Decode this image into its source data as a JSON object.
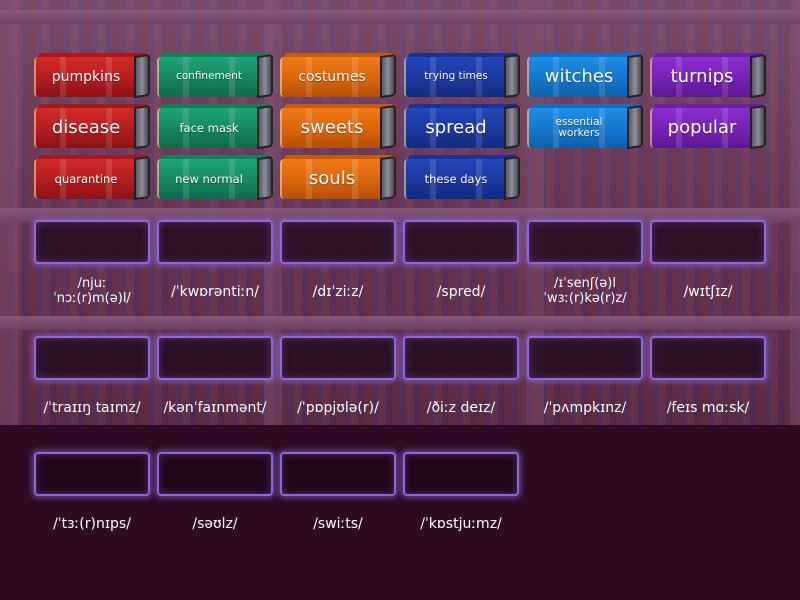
{
  "game": {
    "type": "match-up",
    "tiles": [
      {
        "label": "pumpkins",
        "color": "red"
      },
      {
        "label": "confinement",
        "color": "green"
      },
      {
        "label": "costumes",
        "color": "orange"
      },
      {
        "label": "trying times",
        "color": "navy"
      },
      {
        "label": "witches",
        "color": "blue"
      },
      {
        "label": "turnips",
        "color": "purple"
      },
      {
        "label": "disease",
        "color": "red"
      },
      {
        "label": "face mask",
        "color": "green"
      },
      {
        "label": "sweets",
        "color": "orange"
      },
      {
        "label": "spread",
        "color": "navy"
      },
      {
        "label": "essential workers",
        "color": "blue"
      },
      {
        "label": "popular",
        "color": "purple"
      },
      {
        "label": "quarantine",
        "color": "red"
      },
      {
        "label": "new normal",
        "color": "green"
      },
      {
        "label": "souls",
        "color": "orange"
      },
      {
        "label": "these days",
        "color": "navy"
      }
    ],
    "targets": [
      {
        "phonetic": "/njuː\nˈnɔː(r)m(ə)l/"
      },
      {
        "phonetic": "/ˈkwɒrəntiːn/"
      },
      {
        "phonetic": "/dɪˈziːz/"
      },
      {
        "phonetic": "/spred/"
      },
      {
        "phonetic": "/ɪˈsenʃ(ə)l\nˈwɜː(r)kə(r)z/"
      },
      {
        "phonetic": "/wɪtʃɪz/"
      },
      {
        "phonetic": "/ˈtraɪɪŋ taɪmz/"
      },
      {
        "phonetic": "/kənˈfaɪnmənt/"
      },
      {
        "phonetic": "/ˈpɒpjʊlə(r)/"
      },
      {
        "phonetic": "/ðiːz deɪz/"
      },
      {
        "phonetic": "/ˈpʌmpkɪnz/"
      },
      {
        "phonetic": "/feɪs mɑːsk/"
      },
      {
        "phonetic": "/ˈtɜː(r)nɪps/"
      },
      {
        "phonetic": "/səʊlz/"
      },
      {
        "phonetic": "/swiːts/"
      },
      {
        "phonetic": "/ˈkɒstjuːmz/"
      }
    ]
  }
}
